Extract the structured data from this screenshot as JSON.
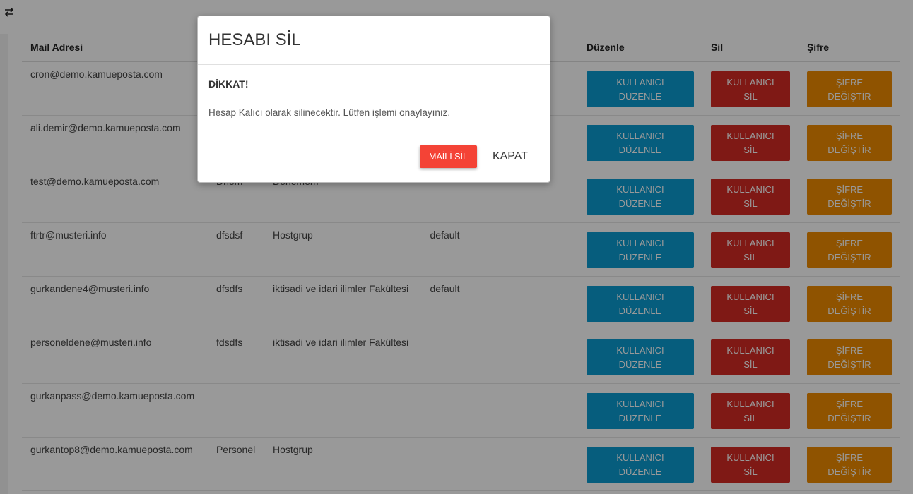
{
  "table": {
    "headers": [
      "Mail Adresi",
      "",
      "",
      "",
      "Düzenle",
      "Sil",
      "Şifre"
    ],
    "rows": [
      {
        "mail": "cron@demo.kamueposta.com",
        "c2": "",
        "c3": "",
        "c4": ""
      },
      {
        "mail": "ali.demir@demo.kamueposta.com",
        "c2": "",
        "c3": "",
        "c4": ""
      },
      {
        "mail": "test@demo.kamueposta.com",
        "c2": "Dnem",
        "c3": "Denemem",
        "c4": ""
      },
      {
        "mail": "ftrtr@musteri.info",
        "c2": "dfsdsf",
        "c3": "Hostgrup",
        "c4": "default"
      },
      {
        "mail": "gurkandene4@musteri.info",
        "c2": "dfsdfs",
        "c3": "iktisadi ve idari ilimler Fakültesi",
        "c4": "default"
      },
      {
        "mail": "personeldene@musteri.info",
        "c2": "fdsdfs",
        "c3": "iktisadi ve idari ilimler Fakültesi",
        "c4": ""
      },
      {
        "mail": "gurkanpass@demo.kamueposta.com",
        "c2": "",
        "c3": "",
        "c4": ""
      },
      {
        "mail": "gurkantop8@demo.kamueposta.com",
        "c2": "Personel",
        "c3": "Hostgrup",
        "c4": ""
      }
    ],
    "edit_label_1": "KULLANICI",
    "edit_label_2": "DÜZENLE",
    "del_label_1": "KULLANICI",
    "del_label_2": "SİL",
    "pw_label_1": "ŞİFRE",
    "pw_label_2": "DEĞİŞTİR"
  },
  "modal": {
    "title": "HESABI SİL",
    "warning_title": "DİKKAT!",
    "warning_text": "Hesap Kalıcı olarak silinecektir. Lütfen işlemi onaylayınız.",
    "delete_label": "MAİLİ SİL",
    "close_label": "KAPAT"
  },
  "icons": {
    "toggle": "swap-arrows-icon"
  },
  "colors": {
    "edit": "#0b9bd0",
    "delete": "#d42b24",
    "password": "#ee8a00",
    "danger": "#f44336"
  }
}
